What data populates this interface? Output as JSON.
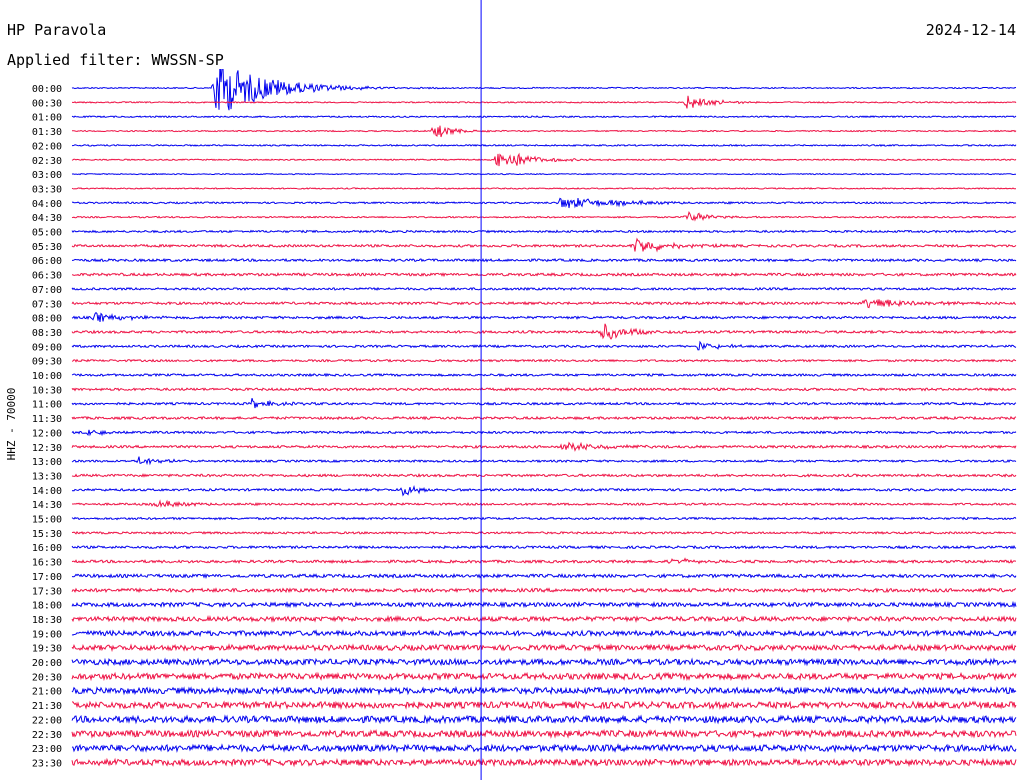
{
  "header": {
    "station": "HP Paravola",
    "filter": "Applied filter: WWSSN-SP",
    "date": "2024-12-14"
  },
  "colors": {
    "even_trace": "#0000ee",
    "odd_trace": "#ee1144",
    "marker": "#0000ff"
  },
  "chart_data": {
    "type": "line",
    "title": "HP Paravola",
    "ylabel": "HHZ - 70000",
    "row_labels": [
      "00:00",
      "00:30",
      "01:00",
      "01:30",
      "02:00",
      "02:30",
      "03:00",
      "03:30",
      "04:00",
      "04:30",
      "05:00",
      "05:30",
      "06:00",
      "06:30",
      "07:00",
      "07:30",
      "08:00",
      "08:30",
      "09:00",
      "09:30",
      "10:00",
      "10:30",
      "11:00",
      "11:30",
      "12:00",
      "12:30",
      "13:00",
      "13:30",
      "14:00",
      "14:30",
      "15:00",
      "15:30",
      "16:00",
      "16:30",
      "17:00",
      "17:30",
      "18:00",
      "18:30",
      "19:00",
      "19:30",
      "20:00",
      "20:30",
      "21:00",
      "21:30",
      "22:00",
      "22:30",
      "23:00",
      "23:30"
    ],
    "row_minutes": 30,
    "current_time_marker_minutes": 13,
    "noise_level_by_row": [
      0.6,
      0.6,
      0.7,
      0.6,
      0.7,
      0.6,
      0.5,
      0.6,
      0.8,
      0.7,
      1.0,
      1.2,
      1.2,
      1.3,
      1.1,
      1.2,
      1.2,
      1.2,
      1.1,
      1.0,
      1.1,
      1.2,
      1.1,
      1.2,
      1.1,
      1.2,
      1.0,
      1.2,
      1.1,
      1.0,
      1.0,
      1.0,
      1.2,
      1.3,
      1.6,
      1.7,
      2.0,
      2.2,
      2.4,
      2.6,
      2.8,
      3.0,
      3.0,
      3.2,
      3.3,
      3.2,
      3.2,
      3.0
    ],
    "events": [
      {
        "row": 0,
        "minute": 4.5,
        "amplitude": 16,
        "duration": 2.5
      },
      {
        "row": 1,
        "minute": 19.5,
        "amplitude": 4,
        "duration": 1.2
      },
      {
        "row": 3,
        "minute": 11.5,
        "amplitude": 4,
        "duration": 1.0
      },
      {
        "row": 5,
        "minute": 13.5,
        "amplitude": 6,
        "duration": 1.5
      },
      {
        "row": 8,
        "minute": 15.5,
        "amplitude": 3,
        "duration": 3.0
      },
      {
        "row": 9,
        "minute": 19.5,
        "amplitude": 3,
        "duration": 1.2
      },
      {
        "row": 11,
        "minute": 17.8,
        "amplitude": 5,
        "duration": 1.5
      },
      {
        "row": 15,
        "minute": 25.2,
        "amplitude": 3,
        "duration": 2.0
      },
      {
        "row": 16,
        "minute": 0.7,
        "amplitude": 2.5,
        "duration": 1.5
      },
      {
        "row": 17,
        "minute": 16.8,
        "amplitude": 5,
        "duration": 1.2
      },
      {
        "row": 18,
        "minute": 19.8,
        "amplitude": 2.5,
        "duration": 1.2
      },
      {
        "row": 22,
        "minute": 5.7,
        "amplitude": 2.5,
        "duration": 1.0
      },
      {
        "row": 24,
        "minute": 0.5,
        "amplitude": 2,
        "duration": 1.0
      },
      {
        "row": 25,
        "minute": 15.5,
        "amplitude": 2.5,
        "duration": 1.8
      },
      {
        "row": 26,
        "minute": 2.1,
        "amplitude": 2.5,
        "duration": 1.0
      },
      {
        "row": 28,
        "minute": 10.5,
        "amplitude": 3,
        "duration": 1.0
      },
      {
        "row": 29,
        "minute": 2.6,
        "amplitude": 2,
        "duration": 1.5
      },
      {
        "row": 33,
        "minute": 19.0,
        "amplitude": 2,
        "duration": 1.0
      }
    ]
  }
}
